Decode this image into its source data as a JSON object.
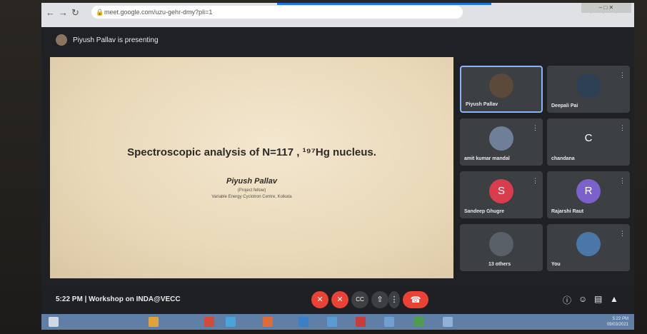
{
  "browser": {
    "url": "meet.google.com/uzu-gehr-dmy?pli=1",
    "extensions": "● ● ●",
    "window_controls": "–  □  ✕"
  },
  "header": {
    "presenting_text": "Piyush Pallav is presenting"
  },
  "slide": {
    "title": "Spectroscopic analysis of N=117 , ¹⁹⁷Hg nucleus.",
    "author": "Piyush Pallav",
    "role": "(Project fellow)",
    "affiliation": "Variable Energy Cyclotron Centre, Kolkata"
  },
  "participants": [
    {
      "name": "Piyush Pallav",
      "initial": "",
      "color": "#5b4a3a",
      "active": true
    },
    {
      "name": "Deepali Pai",
      "initial": "",
      "color": "#2c3f55",
      "active": false
    },
    {
      "name": "amit kumar mandal",
      "initial": "",
      "color": "#6f7f97",
      "active": false
    },
    {
      "name": "chandana",
      "initial": "C",
      "color": "#3c4043",
      "active": false
    },
    {
      "name": "Sandeep Ghugre",
      "initial": "S",
      "color": "#d93d4d",
      "active": false
    },
    {
      "name": "Rajarshi Raut",
      "initial": "R",
      "color": "#7b61c9",
      "active": false
    },
    {
      "name": "13 others",
      "initial": "",
      "color": "#5a6068",
      "active": false
    },
    {
      "name": "You",
      "initial": "",
      "color": "#4a77a8",
      "active": false
    }
  ],
  "bottom": {
    "time": "5:22 PM",
    "separator": "|",
    "meeting_name": "Workshop on INDA@VECC"
  },
  "controls": {
    "mic": "✕",
    "camera": "✕",
    "captions": "CC",
    "present": "⇧",
    "more": "⋮",
    "end_call": "☎",
    "info_icon": "ⓘ",
    "people_icon": "☺",
    "chat_icon": "▤",
    "activities_icon": "▲"
  },
  "taskbar": {
    "clock_time": "5:22 PM",
    "clock_date": "09/03/2021"
  },
  "colors": {
    "accent": "#8ab4f8",
    "danger": "#ea4335",
    "meet_bg": "#202124"
  }
}
